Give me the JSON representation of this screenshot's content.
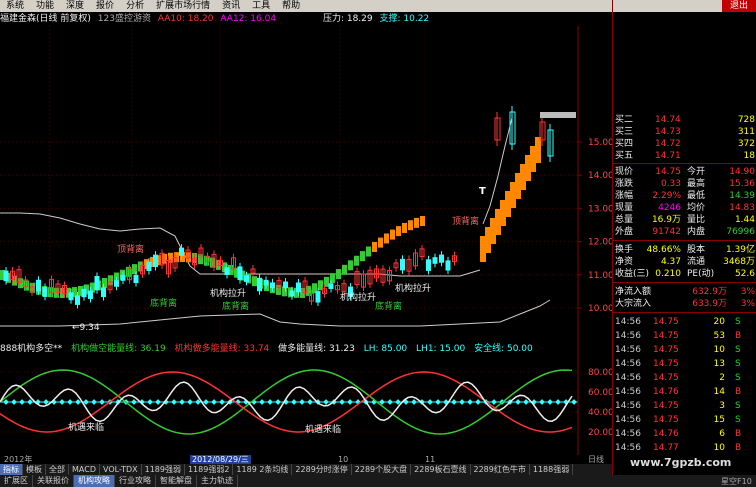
{
  "menu": [
    "系统",
    "功能",
    "深度",
    "报价",
    "分析",
    "扩展市场行情",
    "资讯",
    "工具",
    "帮助"
  ],
  "exit_label": "退出",
  "title": {
    "stock": "福建金森(日线 前复权)",
    "indicator": "123盛控游资",
    "aa10": "AA10: 18.20",
    "aa12": "AA12: 16.04",
    "pressure": "压力: 18.29",
    "support": "支撑: 10.22"
  },
  "price_axis": [
    "15.00",
    "14.00",
    "13.00",
    "12.00",
    "11.00",
    "10.00"
  ],
  "ind_axis": [
    "80.00",
    "60.00",
    "40.00",
    "20.00"
  ],
  "annotations": {
    "top_high": "顶背离",
    "bottom_high": "底背离",
    "institution_lift": "机构拉升",
    "low_mark": "←9.34",
    "t_mark": "T",
    "chance": "机遇来临"
  },
  "ind_legend": [
    {
      "text": "888机构多空**",
      "color": "#eee"
    },
    {
      "text": "机构做空能量线: 36.19",
      "color": "#3c3"
    },
    {
      "text": "机构做多能量线: 33.74",
      "color": "#f33"
    },
    {
      "text": "做多能量线: 31.23",
      "color": "#eee"
    },
    {
      "text": "LH: 85.00",
      "color": "#3ff"
    },
    {
      "text": "LH1: 15.00",
      "color": "#3ff"
    },
    {
      "text": "安全线: 50.00",
      "color": "#3ff"
    }
  ],
  "dates": {
    "year": "2012年",
    "mid": "2012/08/29/三",
    "d10": "10",
    "d11": "11",
    "daily": "日线"
  },
  "tabs1": [
    "指标",
    "模板",
    "全部",
    "MACD",
    "VOL-TDX",
    "1189强弱",
    "1189强弱2",
    "1189 2条均线",
    "2289分时涨停",
    "2289个股大盘",
    "2289板石壹线",
    "2289红色牛市",
    "1188强弱"
  ],
  "tabs2": [
    "扩展区",
    "关联报价",
    "机构攻略",
    "行业攻略",
    "智能解盘",
    "主力轨迹"
  ],
  "watermark": "www.7gpzb.com",
  "f10": "星空F10",
  "orderbook": [
    {
      "label": "买二",
      "price": "14.74",
      "vol": "728"
    },
    {
      "label": "买三",
      "price": "14.73",
      "vol": "311"
    },
    {
      "label": "买四",
      "price": "14.72",
      "vol": "372"
    },
    {
      "label": "买五",
      "price": "14.71",
      "vol": "18"
    }
  ],
  "stats": [
    {
      "l": "现价",
      "lv": "14.75",
      "r": "今开",
      "rv": "14.90"
    },
    {
      "l": "涨跌",
      "lv": "0.33",
      "r": "最高",
      "rv": "15.36"
    },
    {
      "l": "涨幅",
      "lv": "2.29%",
      "r": "最低",
      "rv": "14.39"
    },
    {
      "l": "现量",
      "lv": "4246",
      "r": "均价",
      "rv": "14.83"
    },
    {
      "l": "总量",
      "lv": "16.9万",
      "r": "量比",
      "rv": "1.44"
    },
    {
      "l": "外盘",
      "lv": "91742",
      "r": "内盘",
      "rv": "76996"
    }
  ],
  "stats2": [
    {
      "l": "换手",
      "lv": "48.66%",
      "r": "股本",
      "rv": "1.39亿"
    },
    {
      "l": "净资",
      "lv": "4.37",
      "r": "流通",
      "rv": "3468万"
    },
    {
      "l": "收益(三)",
      "lv": "0.210",
      "r": "PE(动)",
      "rv": "52.6"
    }
  ],
  "flows": [
    {
      "l": "净流入额",
      "v": "632.9万",
      "p": "3%"
    },
    {
      "l": "大宗流入",
      "v": "633.9万",
      "p": "3%"
    }
  ],
  "ticks": [
    {
      "t": "14:56",
      "p": "14.75",
      "v": "20",
      "s": "S"
    },
    {
      "t": "14:56",
      "p": "14.75",
      "v": "53",
      "s": "B"
    },
    {
      "t": "14:56",
      "p": "14.75",
      "v": "10",
      "s": "S"
    },
    {
      "t": "14:56",
      "p": "14.75",
      "v": "13",
      "s": "S"
    },
    {
      "t": "14:56",
      "p": "14.75",
      "v": "2",
      "s": "S"
    },
    {
      "t": "14:56",
      "p": "14.76",
      "v": "14",
      "s": "B"
    },
    {
      "t": "14:56",
      "p": "14.75",
      "v": "3",
      "s": "S"
    },
    {
      "t": "14:56",
      "p": "14.75",
      "v": "15",
      "s": "S"
    },
    {
      "t": "14:56",
      "p": "14.76",
      "v": "6",
      "s": "B"
    },
    {
      "t": "14:56",
      "p": "14.77",
      "v": "10",
      "s": "B"
    }
  ]
}
